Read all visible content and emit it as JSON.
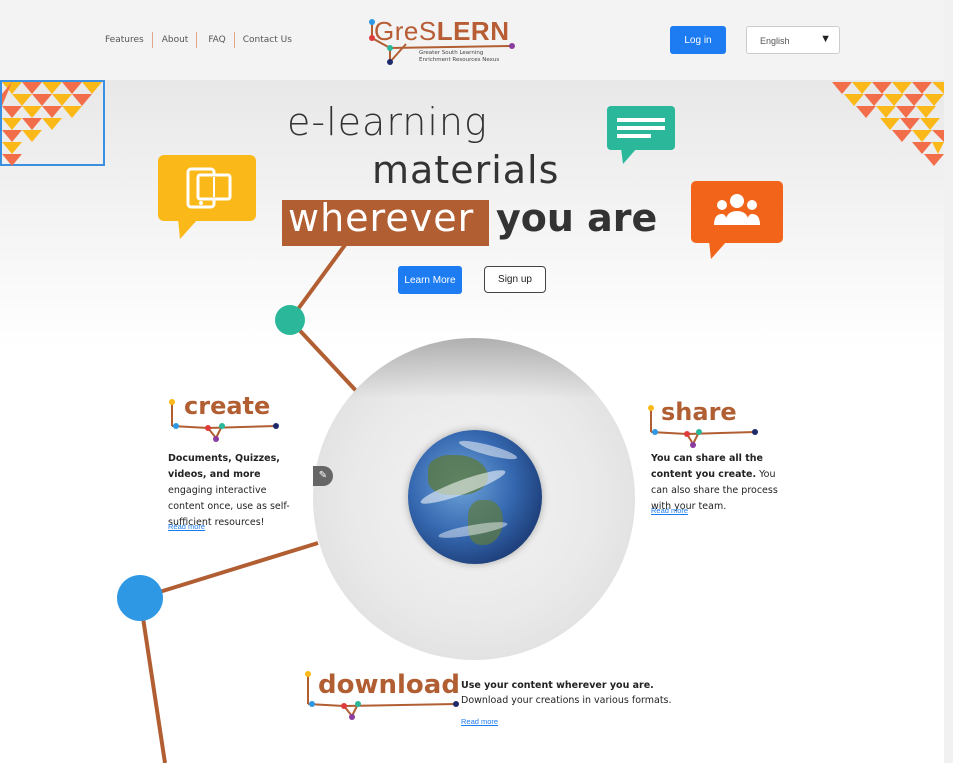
{
  "nav": {
    "items": [
      "Features",
      "About",
      "FAQ",
      "Contact Us"
    ]
  },
  "logo": {
    "word_a": "GreS",
    "word_b": "LERN",
    "subtitle_line1": "Greater South Learning",
    "subtitle_line2": "Enrichment Resources Nexus"
  },
  "header": {
    "login_label": "Log in",
    "language": "English"
  },
  "hero": {
    "line1": "e-learning",
    "line2": "materials",
    "line3a": "wherever",
    "line3b": "you are",
    "learn_more_label": "Learn More",
    "signup_label": "Sign up"
  },
  "create": {
    "title": "create",
    "text_bold": "Documents, Quizzes, videos, and more",
    "text_rest": " engaging interactive content once, use as self-sufficient resources!",
    "read_more": "Read more"
  },
  "share": {
    "title": "share",
    "text_bold": "You can share all the content you create.",
    "text_rest": " You can also share the process with your team.",
    "read_more": "Read more"
  },
  "download": {
    "title": "download",
    "text_bold": "Use your content wherever you are.",
    "text_rest": "Download your creations in various formats.",
    "read_more": "Read more"
  },
  "colors": {
    "brand_brown": "#b25e33",
    "accent_blue": "#1d7cf2",
    "teal": "#2bb89a",
    "yellow": "#fbb919",
    "orange": "#f26419",
    "node_blue": "#2f98e4"
  },
  "icons": {
    "tablet_book": "tablet-book-icon",
    "chat_lines": "chat-lines-icon",
    "team": "team-icon",
    "edit": "edit-icon",
    "dropdown": "chevron-down-icon"
  }
}
